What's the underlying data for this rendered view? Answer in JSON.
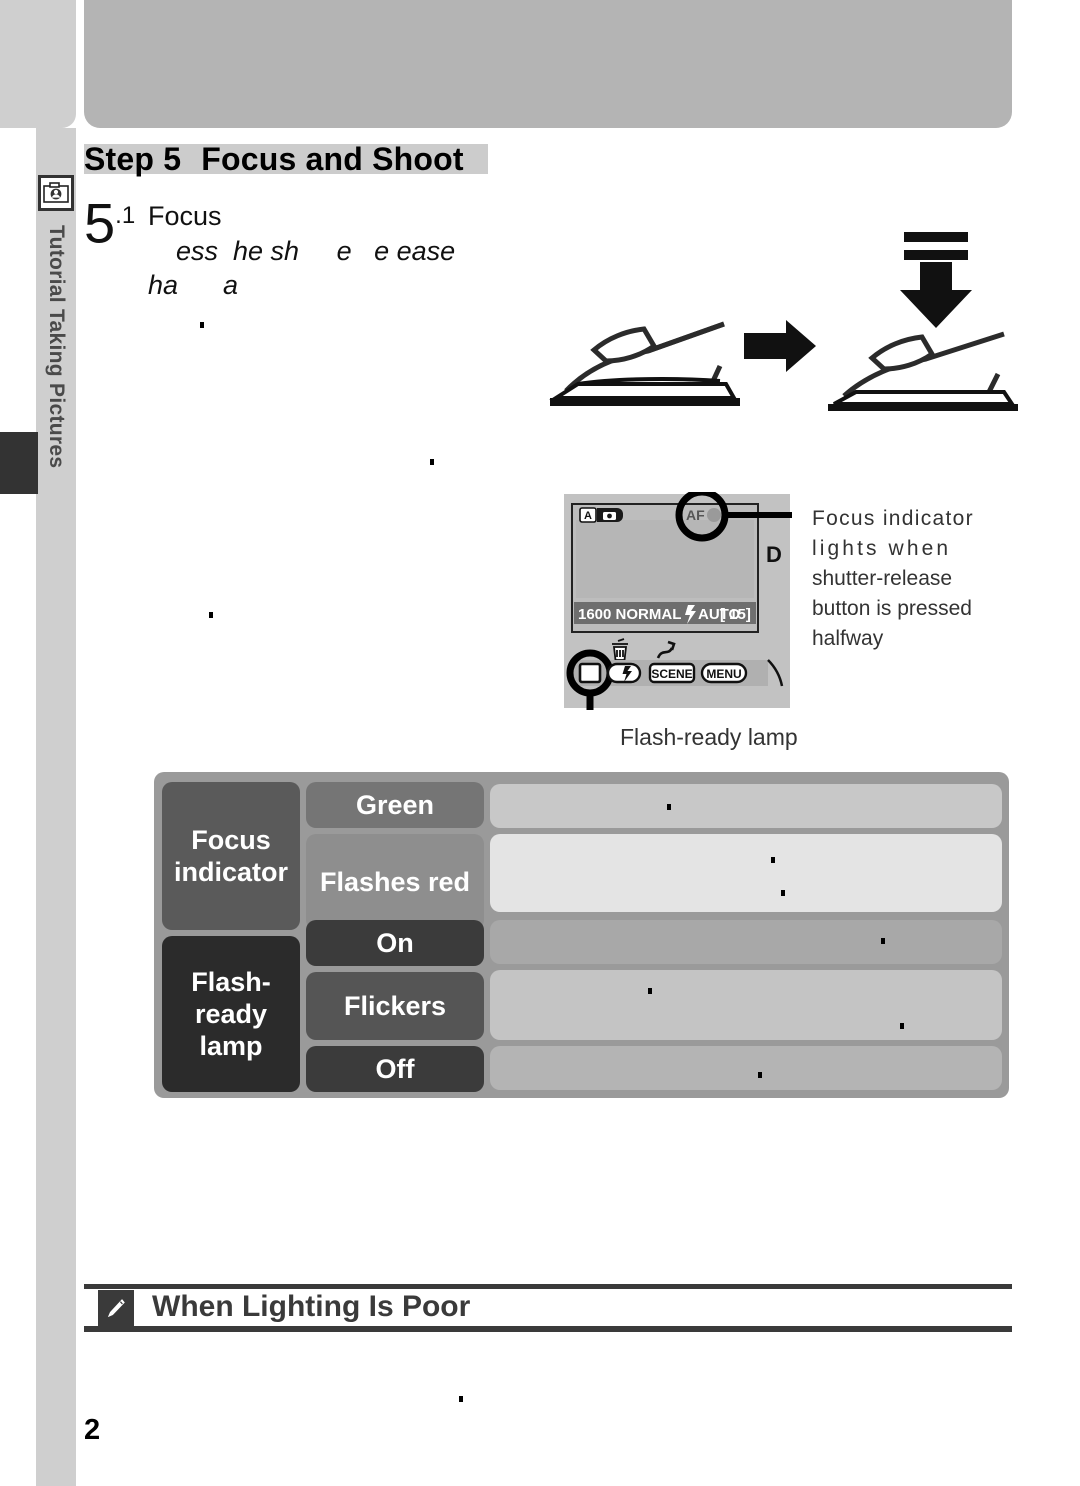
{
  "page": {
    "number": "2",
    "sidebar": {
      "icon": "camera-tutorial-icon",
      "label": "Tutorial   Taking Pictures"
    }
  },
  "step": {
    "title_prefix": "Step 5",
    "title_main": "Focus and Shoot",
    "number": "5",
    "number_sub": ".1",
    "heading": "Focus",
    "body_line_1": "ess  he sh     e   e ease",
    "body_line_2": "ha      a"
  },
  "illustration": {
    "shutter": {
      "name": "shutter-button-press-illustration",
      "arrow_right": "arrow-right-icon",
      "arrow_down": "arrow-down-icon"
    },
    "camera_lcd": {
      "name": "camera-lcd-illustration",
      "mode_badge": "A",
      "mode_icon": "camera-icon",
      "af_label": "AF",
      "partial_text": "D",
      "status_bar": {
        "iso": "1600",
        "quality": "NORMAL",
        "flash_icon": "flash-bolt-icon",
        "flash_mode": "AUTO",
        "frames_left": "[  15]"
      },
      "buttons": {
        "trash": "trash-icon",
        "transfer": "transfer-icon",
        "monitor": "monitor-button",
        "flash": "flash-button",
        "scene": "SCENE",
        "menu": "MENU"
      }
    }
  },
  "callouts": {
    "focus_indicator": {
      "line1": "Focus indicator",
      "line2": "lights  when",
      "line3": "shutter-release",
      "line4": "button is pressed",
      "line5": "halfway"
    },
    "flash_ready": "Flash-ready lamp"
  },
  "table": {
    "rows": [
      {
        "group": "Focus indicator",
        "states": [
          {
            "key": "Green",
            "value": ""
          },
          {
            "key": "Flashes red",
            "value": ""
          }
        ]
      },
      {
        "group": "Flash-ready lamp",
        "states": [
          {
            "key": "On",
            "value": ""
          },
          {
            "key": "Flickers",
            "value": ""
          },
          {
            "key": "Off",
            "value": ""
          }
        ]
      }
    ],
    "group_labels": {
      "focus": "Focus indicator",
      "flash": "Flash-ready lamp"
    },
    "keys": {
      "green": "Green",
      "flashes_red": "Flashes red",
      "on": "On",
      "flickers": "Flickers",
      "off": "Off"
    }
  },
  "note": {
    "icon": "pencil-note-icon",
    "title": "When Lighting Is Poor"
  },
  "colors": {
    "banner": "#b4b4b4",
    "sidebar": "#cfcfcf",
    "tab_dark": "#333333",
    "table_frame": "#9a9a9a",
    "rowhead_focus": "#5a5a5a",
    "rowhead_flash": "#2b2b2b",
    "rule": "#3a3a3a"
  }
}
